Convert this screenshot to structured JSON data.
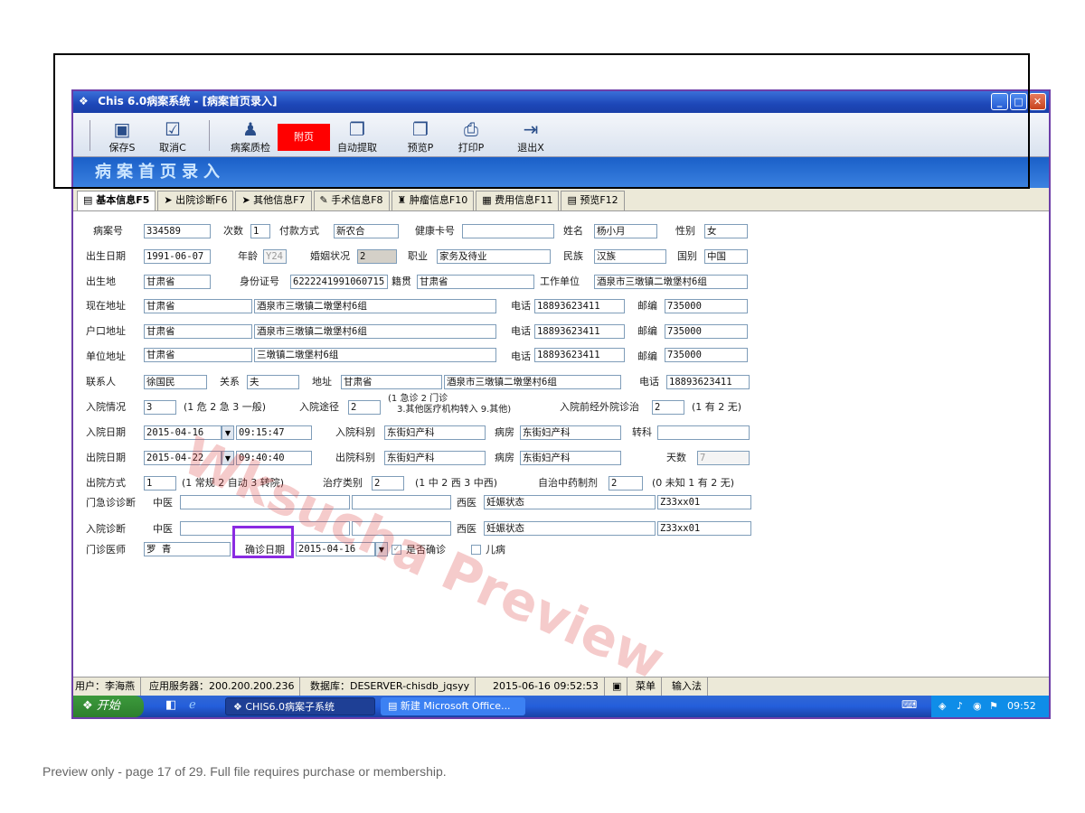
{
  "window": {
    "title": "Chis 6.0病案系统 - [病案首页录入]",
    "controls": [
      "_",
      "□",
      "✕"
    ]
  },
  "toolbar": {
    "save": "保存S",
    "cancel": "取消C",
    "quality": "病案质检",
    "red_label": "附页",
    "auto_extract": "自动提取",
    "preview": "预览P",
    "print": "打印P",
    "exit": "退出X"
  },
  "banner": {
    "title": "病案首页录入"
  },
  "tabs": [
    "基本信息F5",
    "出院诊断F6",
    "其他信息F7",
    "手术信息F8",
    "肿瘤信息F10",
    "费用信息F11",
    "预览F12"
  ],
  "form": {
    "record_no_label": "病案号",
    "record_no": "334589",
    "times_label": "次数",
    "times": "1",
    "payment_label": "付款方式",
    "payment": "新农合",
    "health_card_label": "健康卡号",
    "health_card": "",
    "name_label": "姓名",
    "name": "杨小月",
    "sex_label": "性别",
    "sex": "女",
    "birth_date_label": "出生日期",
    "birth_date": "1991-06-07",
    "age_label": "年龄",
    "age": "Y24",
    "marital_label": "婚姻状况",
    "marital": "2",
    "occupation_label": "职业",
    "occupation": "家务及待业",
    "ethnicity_label": "民族",
    "ethnicity": "汉族",
    "country_label": "国别",
    "country": "中国",
    "birthplace_label": "出生地",
    "birthplace": "甘肃省",
    "id_label": "身份证号",
    "id_no": "6222241991060715",
    "native_label": "籍贯",
    "native": "甘肃省",
    "work_unit_label": "工作单位",
    "work_unit": "酒泉市三墩镇二墩堡村6组",
    "current_addr_label": "现在地址",
    "current_addr_prov": "甘肃省",
    "current_addr": "酒泉市三墩镇二墩堡村6组",
    "phone_label": "电话",
    "phone": "18893623411",
    "zip_label": "邮编",
    "zip": "735000",
    "hukou_addr_label": "户口地址",
    "hukou_prov": "甘肃省",
    "hukou_addr": "酒泉市三墩镇二墩堡村6组",
    "unit_addr_label": "单位地址",
    "unit_prov": "甘肃省",
    "unit_addr": "三墩镇二墩堡村6组",
    "contact_label": "联系人",
    "contact": "徐国民",
    "relation_label": "关系",
    "relation": "夫",
    "address_label": "地址",
    "contact_prov": "甘肃省",
    "contact_addr": "酒泉市三墩镇二墩堡村6组",
    "contact_phone": "18893623411",
    "admit_cond_label": "入院情况",
    "admit_cond": "3",
    "admit_cond_hint": "(1 危 2 急 3 一般)",
    "admit_route_label": "入院途径",
    "admit_route": "2",
    "admit_route_hint1": "(1 急诊      2 门诊",
    "admit_route_hint2": "3.其他医疗机构转入  9.其他)",
    "prior_treat_label": "入院前经外院诊治",
    "prior_treat": "2",
    "prior_treat_hint": "(1 有 2 无)",
    "admit_date_label": "入院日期",
    "admit_date": "2015-04-16",
    "admit_time": "09:15:47",
    "admit_dept_label": "入院科别",
    "admit_dept": "东街妇产科",
    "ward_label": "病房",
    "admit_ward": "东街妇产科",
    "transfer_label": "转科",
    "transfer": "",
    "discharge_date_label": "出院日期",
    "discharge_date": "2015-04-22",
    "discharge_time": "09:40:40",
    "discharge_dept_label": "出院科别",
    "discharge_dept": "东街妇产科",
    "discharge_ward": "东街妇产科",
    "days_label": "天数",
    "days": "7",
    "discharge_mode_label": "出院方式",
    "discharge_mode": "1",
    "discharge_mode_hint": "(1 常规 2 自动 3 转院)",
    "treat_type_label": "治疗类别",
    "treat_type": "2",
    "treat_type_hint": "(1 中 2 西 3 中西)",
    "self_prep_label": "自治中药制剂",
    "self_prep": "2",
    "self_prep_hint": "(0 未知 1 有 2 无)",
    "er_diag_label": "门急诊诊断",
    "tcm_label": "中医",
    "western_label": "西医",
    "er_tcm": "",
    "er_tcm2": "",
    "er_western": "妊娠状态",
    "er_code": "Z33xx01",
    "admit_diag_label": "入院诊断",
    "admit_tcm": "",
    "admit_tcm2": "",
    "admit_western": "妊娠状态",
    "admit_code": "Z33xx01",
    "doctor_label": "门诊医师",
    "doctor": "罗  青",
    "confirm_date_label": "确诊日期",
    "confirm_date": "2015-04-16",
    "confirmed_label": "是否确诊",
    "child_label": "儿病"
  },
  "status": {
    "user": "用户：李海燕",
    "server": "应用服务器：200.200.200.236",
    "db": "数据库：DESERVER-chisdb_jqsyy",
    "time": "2015-06-16 09:52:53",
    "menu": "菜单",
    "ime": "输入法"
  },
  "taskbar": {
    "start": "开始",
    "task1": "CHIS6.0病案子系统",
    "task2": "新建 Microsoft Office...",
    "clock": "09:52"
  },
  "watermark": "Wksucha Preview",
  "footer": "Preview only - page 17 of 29. Full file requires purchase or membership."
}
